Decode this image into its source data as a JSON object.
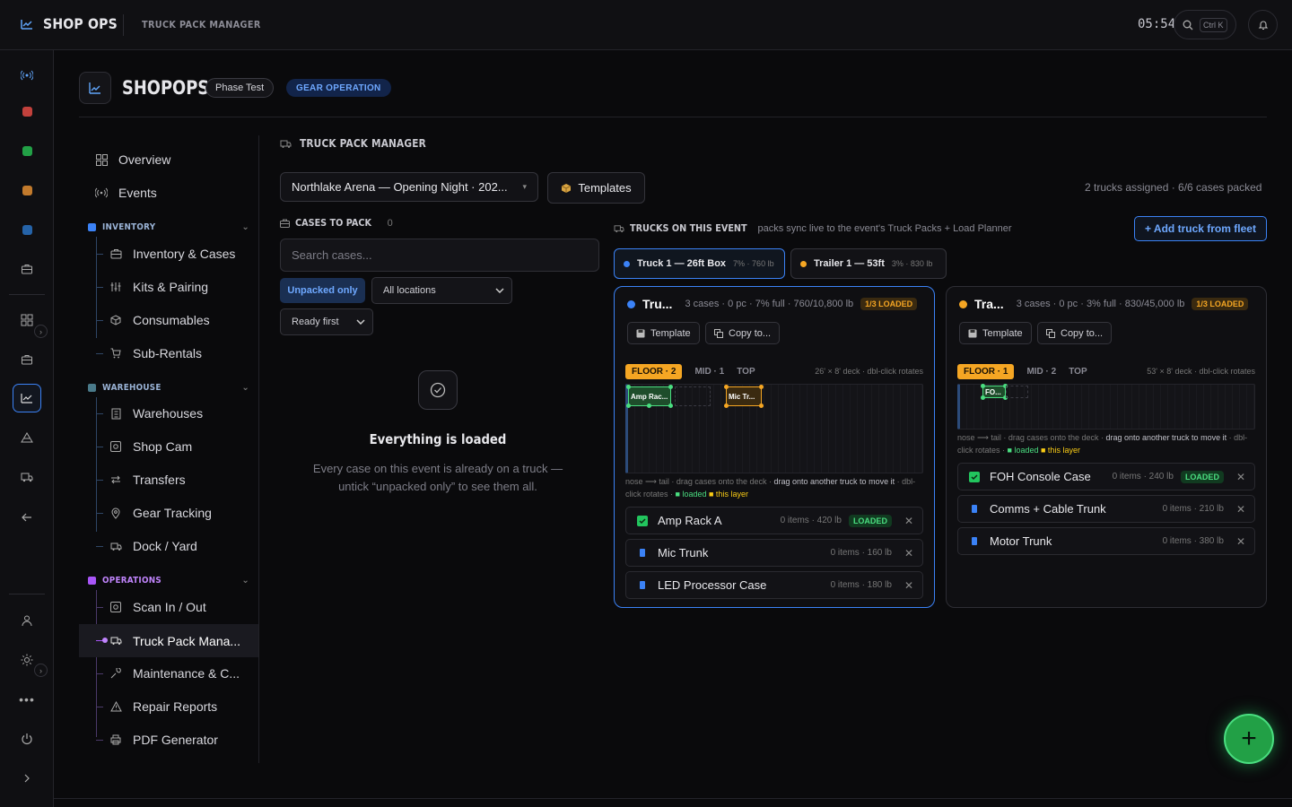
{
  "topbar": {
    "brand": "SHOP OPS",
    "module": "TRUCK PACK MANAGER",
    "clock": "05:54",
    "kbd": "Ctrl K"
  },
  "header": {
    "title": "SHOPOPS",
    "phase": "Phase Test",
    "mode": "GEAR OPERATION"
  },
  "nav": {
    "overview": "Overview",
    "events": "Events",
    "inventory_title": "INVENTORY",
    "inventory": [
      "Inventory & Cases",
      "Kits & Pairing",
      "Consumables",
      "Sub-Rentals"
    ],
    "warehouse_title": "WAREHOUSE",
    "warehouse": [
      "Warehouses",
      "Shop Cam",
      "Transfers",
      "Gear Tracking",
      "Dock / Yard"
    ],
    "operations_title": "OPERATIONS",
    "operations": [
      "Scan In / Out",
      "Truck Pack Mana...",
      "Maintenance & C...",
      "Repair Reports",
      "PDF Generator"
    ]
  },
  "main": {
    "title": "TRUCK PACK MANAGER",
    "event": "Northlake Arena — Opening Night · 202...",
    "templates": "Templates",
    "summary": "2 trucks assigned · 6/6 cases packed",
    "cases_title": "CASES TO PACK",
    "cases_count": "0",
    "search_placeholder": "Search cases...",
    "unpacked": "Unpacked only",
    "locations": "All locations",
    "sort": "Ready first",
    "empty_title": "Everything is loaded",
    "empty_sub": "Every case on this event is already on a truck — untick “unpacked only” to see them all.",
    "trucks_title": "TRUCKS ON THIS EVENT",
    "trucks_sub": "packs sync live to the event's Truck Packs + Load Planner",
    "add_truck": "+ Add truck from fleet"
  },
  "tabs": [
    {
      "name": "Truck 1 — 26ft Box",
      "meta": "7% · 760 lb",
      "color": "#3b82f6"
    },
    {
      "name": "Trailer 1 — 53ft",
      "meta": "3% · 830 lb",
      "color": "#f5a623"
    }
  ],
  "trucks": [
    {
      "name": "Tru...",
      "meta": "3 cases · 0 pc · 7% full · 760/10,800 lb",
      "badge": "1/3 LOADED",
      "dot": "#3b82f6",
      "template": "Template",
      "copy": "Copy to...",
      "l1": "FLOOR · 2",
      "l2": "MID · 1",
      "l3": "TOP",
      "deck": "26' × 8' deck · dbl-click rotates",
      "boxes": [
        "Amp Rac...",
        "Mic Tr..."
      ],
      "cases": [
        {
          "name": "Amp Rack A",
          "meta": "0 items · 420 lb",
          "loaded": "LOADED",
          "ck": "green"
        },
        {
          "name": "Mic Trunk",
          "meta": "0 items · 160 lb",
          "loaded": "",
          "ck": "blue"
        },
        {
          "name": "LED Processor Case",
          "meta": "0 items · 180 lb",
          "loaded": "",
          "ck": "blue"
        }
      ]
    },
    {
      "name": "Tra...",
      "meta": "3 cases · 0 pc · 3% full · 830/45,000 lb",
      "badge": "1/3 LOADED",
      "dot": "#f5a623",
      "template": "Template",
      "copy": "Copy to...",
      "l1": "FLOOR · 1",
      "l2": "MID · 2",
      "l3": "TOP",
      "deck": "53' × 8' deck · dbl-click rotates",
      "boxes": [
        "FO..."
      ],
      "cases": [
        {
          "name": "FOH Console Case",
          "meta": "0 items · 240 lb",
          "loaded": "LOADED",
          "ck": "green"
        },
        {
          "name": "Comms + Cable Trunk",
          "meta": "0 items · 210 lb",
          "loaded": "",
          "ck": "blue"
        },
        {
          "name": "Motor Trunk",
          "meta": "0 items · 380 lb",
          "loaded": "",
          "ck": "blue"
        }
      ]
    }
  ],
  "hint": {
    "a": "nose ⟶ tail · drag cases onto the deck · ",
    "b": "drag onto another truck to move it",
    "c": " · dbl-click rotates · ",
    "loaded": "■ loaded",
    "layer": "■ this layer"
  },
  "colors": {
    "accent": "#3b82f6",
    "loaded": "#4ade80",
    "floor": "#f5a623",
    "fab": "#22a046"
  }
}
